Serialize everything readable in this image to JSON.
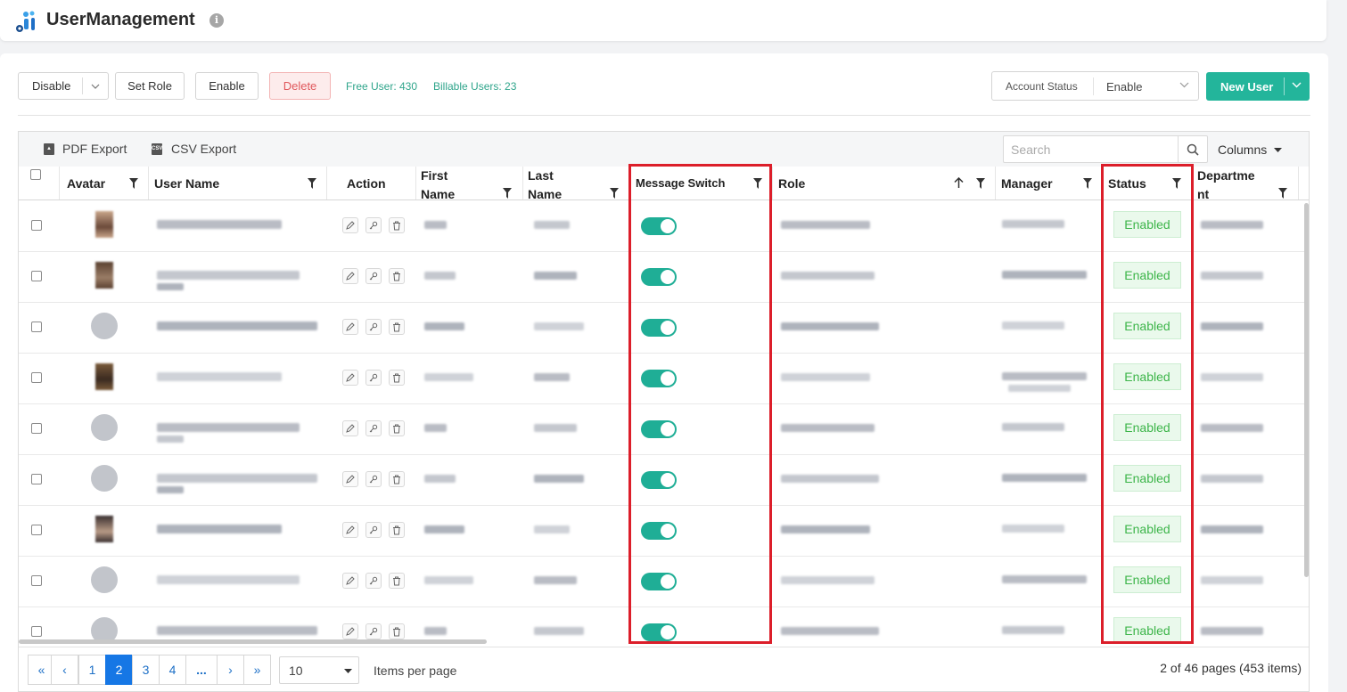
{
  "header": {
    "title": "UserManagement",
    "info_icon": "info-icon"
  },
  "toolbar": {
    "disable_label": "Disable",
    "set_role_label": "Set Role",
    "enable_label": "Enable",
    "delete_label": "Delete",
    "free_user": "Free User: 430",
    "billable_users": "Billable Users: 23",
    "account_status_label": "Account Status",
    "account_status_value": "Enable",
    "new_user_label": "New User"
  },
  "grid_toolbar": {
    "pdf_export": "PDF Export",
    "csv_export": "CSV Export",
    "search_placeholder": "Search",
    "columns_label": "Columns"
  },
  "columns": {
    "avatar": "Avatar",
    "user_name": "User Name",
    "action": "Action",
    "first_name_1": "First",
    "first_name_2": "Name",
    "last_name_1": "Last",
    "last_name_2": "Name",
    "message_switch": "Message Switch",
    "role": "Role",
    "manager": "Manager",
    "status": "Status",
    "department_1": "Departme",
    "department_2": "nt"
  },
  "rows": [
    {
      "avatar": "photo",
      "message_switch": true,
      "status": "Enabled"
    },
    {
      "avatar": "photo",
      "message_switch": true,
      "status": "Enabled"
    },
    {
      "avatar": "placeholder",
      "message_switch": true,
      "status": "Enabled"
    },
    {
      "avatar": "photo",
      "message_switch": true,
      "status": "Enabled"
    },
    {
      "avatar": "placeholder",
      "message_switch": true,
      "status": "Enabled"
    },
    {
      "avatar": "placeholder",
      "message_switch": true,
      "status": "Enabled"
    },
    {
      "avatar": "photo",
      "message_switch": true,
      "status": "Enabled"
    },
    {
      "avatar": "placeholder",
      "message_switch": true,
      "status": "Enabled"
    },
    {
      "avatar": "placeholder",
      "message_switch": true,
      "status": "Enabled"
    }
  ],
  "pagination": {
    "first": "«",
    "prev": "‹",
    "pages": [
      "1",
      "2",
      "3",
      "4",
      "..."
    ],
    "current": "2",
    "next": "›",
    "last": "»",
    "page_size": "10",
    "items_per_page": "Items per page",
    "info": "2 of 46 pages (453 items)"
  },
  "colors": {
    "accent": "#23b59b",
    "toggle_on": "#1fae96",
    "highlight": "#dc1e2a",
    "status_text": "#3db54a",
    "page_active": "#1677e5"
  }
}
